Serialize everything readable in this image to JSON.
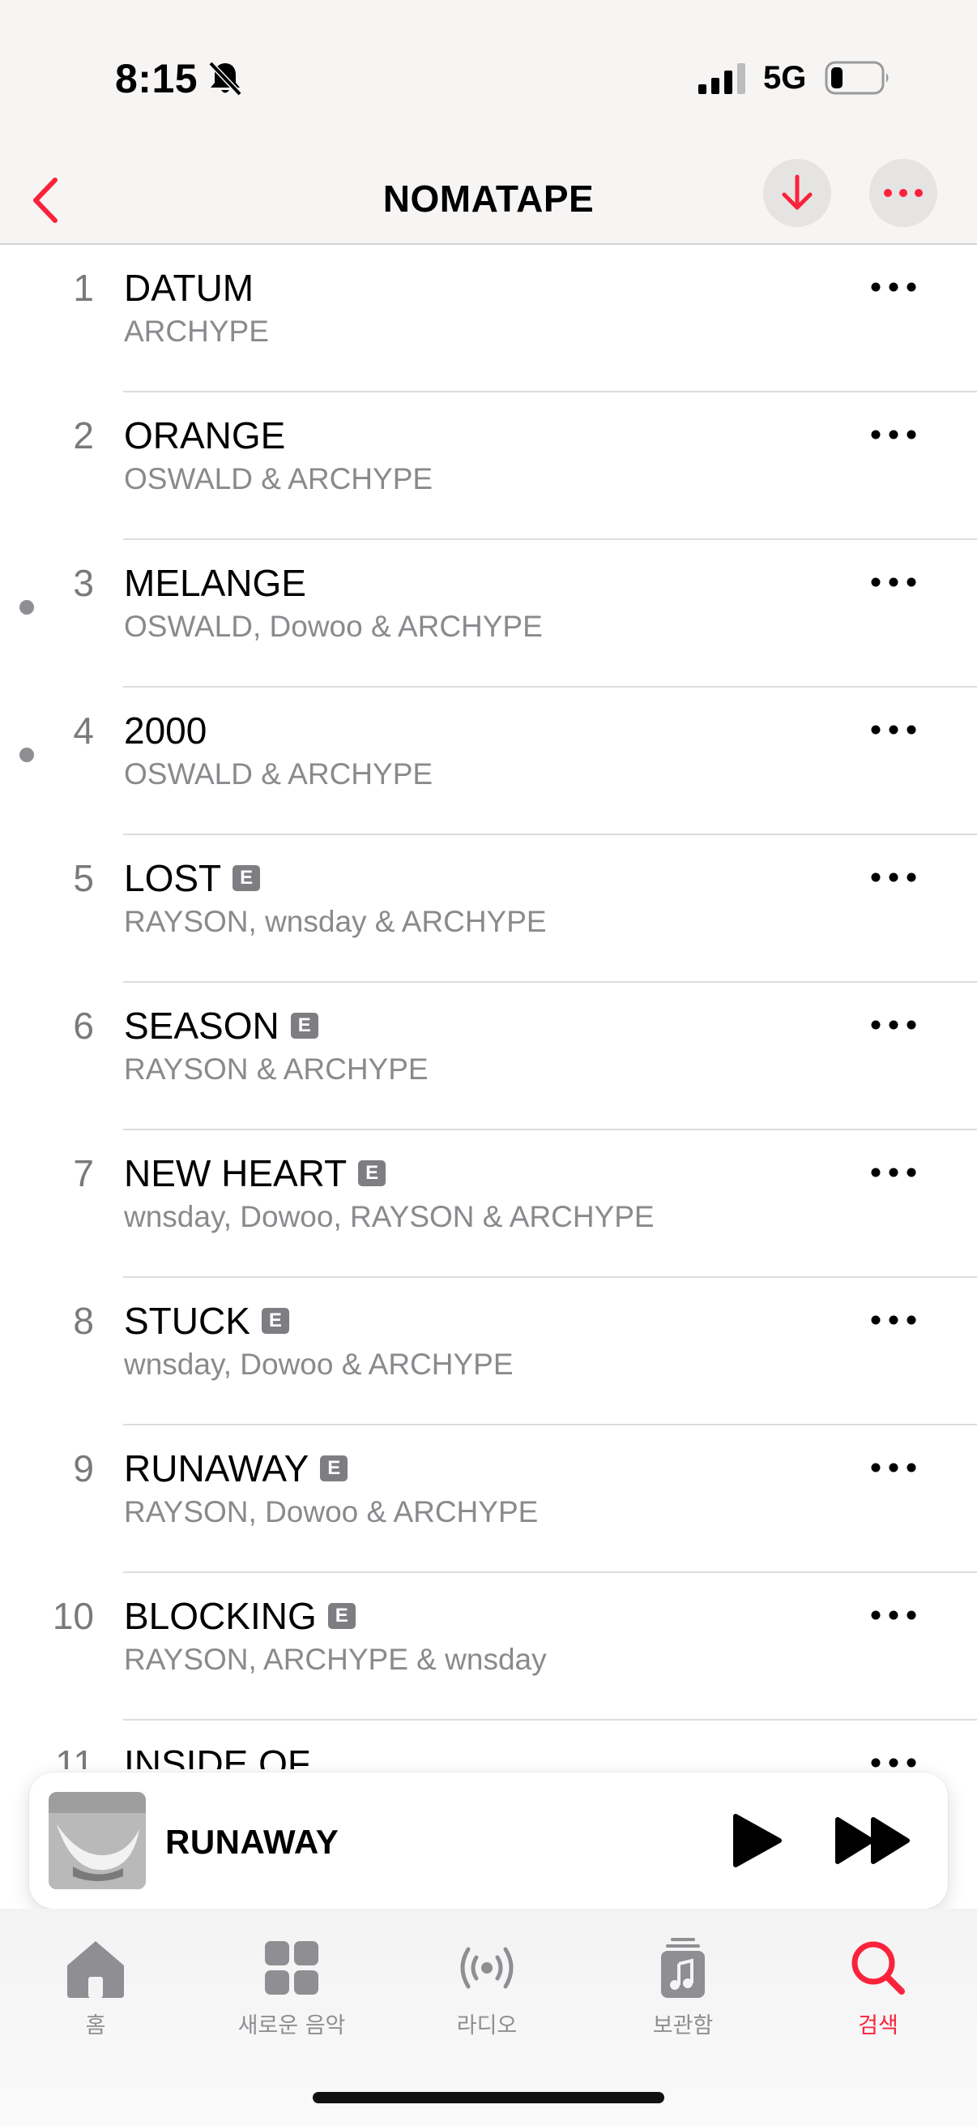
{
  "status_bar": {
    "time": "8:15",
    "network": "5G"
  },
  "nav": {
    "title": "NOMATAPE"
  },
  "colors": {
    "accent": "#fa233b",
    "secondary_text": "#8a8a8e",
    "badge": "#7e7e82"
  },
  "tracks": [
    {
      "number": "1",
      "title": "DATUM",
      "artist": "ARCHYPE",
      "explicit": false,
      "dot": false
    },
    {
      "number": "2",
      "title": "ORANGE",
      "artist": "OSWALD & ARCHYPE",
      "explicit": false,
      "dot": false
    },
    {
      "number": "3",
      "title": "MELANGE",
      "artist": "OSWALD, Dowoo & ARCHYPE",
      "explicit": false,
      "dot": true
    },
    {
      "number": "4",
      "title": "2000",
      "artist": "OSWALD & ARCHYPE",
      "explicit": false,
      "dot": true
    },
    {
      "number": "5",
      "title": "LOST",
      "artist": "RAYSON, wnsday & ARCHYPE",
      "explicit": true,
      "dot": false
    },
    {
      "number": "6",
      "title": "SEASON",
      "artist": "RAYSON & ARCHYPE",
      "explicit": true,
      "dot": false
    },
    {
      "number": "7",
      "title": "NEW HEART",
      "artist": "wnsday, Dowoo, RAYSON & ARCHYPE",
      "explicit": true,
      "dot": false
    },
    {
      "number": "8",
      "title": "STUCK",
      "artist": "wnsday, Dowoo & ARCHYPE",
      "explicit": true,
      "dot": false
    },
    {
      "number": "9",
      "title": "RUNAWAY",
      "artist": "RAYSON, Dowoo & ARCHYPE",
      "explicit": true,
      "dot": false
    },
    {
      "number": "10",
      "title": "BLOCKING",
      "artist": "RAYSON, ARCHYPE & wnsday",
      "explicit": true,
      "dot": false
    },
    {
      "number": "11",
      "title": "INSIDE OF",
      "artist": "",
      "explicit": false,
      "dot": false
    }
  ],
  "explicit_label": "E",
  "mini_player": {
    "title": "RUNAWAY"
  },
  "tabs": [
    {
      "label": "홈",
      "icon": "home-icon",
      "active": false
    },
    {
      "label": "새로운 음악",
      "icon": "grid-icon",
      "active": false
    },
    {
      "label": "라디오",
      "icon": "radio-icon",
      "active": false
    },
    {
      "label": "보관함",
      "icon": "library-icon",
      "active": false
    },
    {
      "label": "검색",
      "icon": "search-icon",
      "active": true
    }
  ]
}
